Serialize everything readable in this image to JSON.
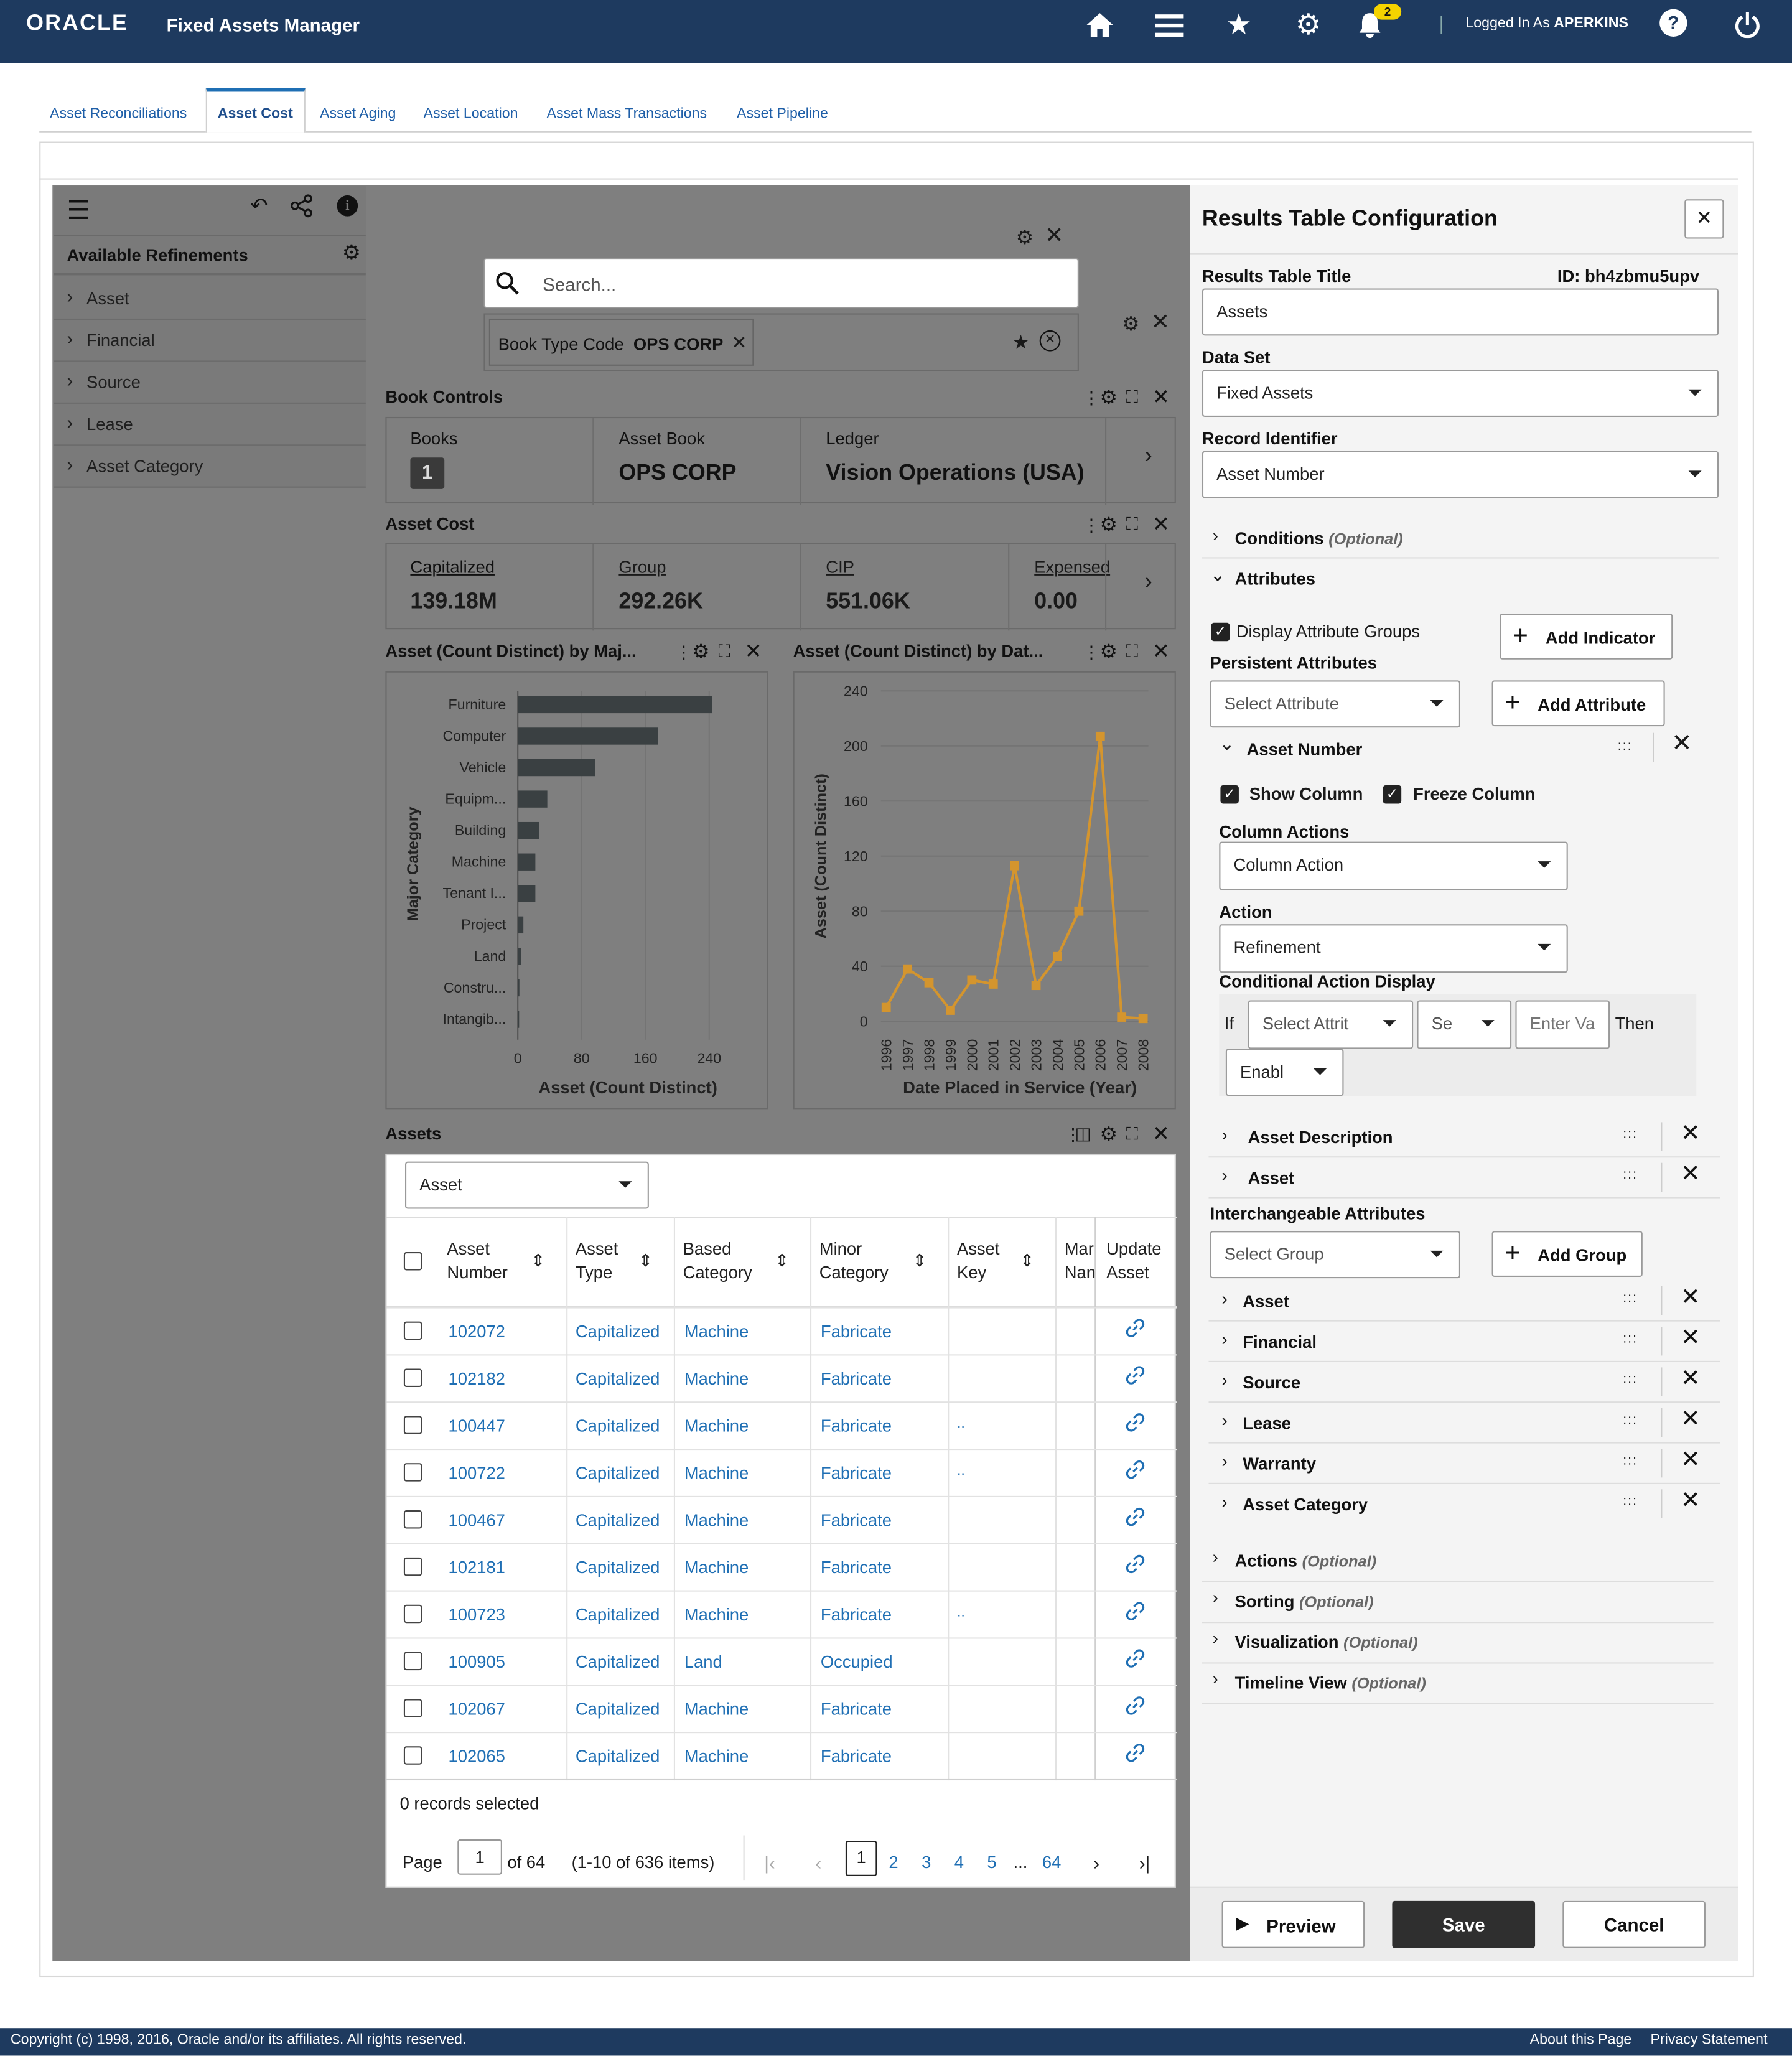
{
  "app": {
    "logo": "ORACLE",
    "title": "Fixed Assets Manager",
    "notification_count": "2",
    "logged_in_prefix": "Logged In As",
    "user": "APERKINS",
    "nav_icons": [
      "home-icon",
      "menu-icon",
      "star-icon",
      "gear-icon",
      "bell-icon",
      "help-icon",
      "power-icon"
    ]
  },
  "tabs": [
    "Asset Reconciliations",
    "Asset Cost",
    "Asset Aging",
    "Asset Location",
    "Asset Mass Transactions",
    "Asset Pipeline"
  ],
  "active_tab": "Asset Cost",
  "refinements": {
    "title": "Available Refinements",
    "items": [
      "Asset",
      "Financial",
      "Source",
      "Lease",
      "Asset Category"
    ]
  },
  "search": {
    "placeholder": "Search...",
    "chip_label": "Book Type Code",
    "chip_value": "OPS CORP"
  },
  "book_controls": {
    "title": "Book Controls",
    "books_label": "Books",
    "books_value": "1",
    "asset_book_label": "Asset Book",
    "asset_book_value": "OPS CORP",
    "ledger_label": "Ledger",
    "ledger_value": "Vision Operations (USA)"
  },
  "asset_cost": {
    "title": "Asset Cost",
    "metrics": [
      {
        "label": "Capitalized",
        "value": "139.18M"
      },
      {
        "label": "Group",
        "value": "292.26K"
      },
      {
        "label": "CIP",
        "value": "551.06K"
      },
      {
        "label": "Expensed",
        "value": "0.00"
      }
    ]
  },
  "charts": {
    "bar_title": "Asset (Count Distinct) by Maj...",
    "line_title": "Asset (Count Distinct) by Dat..."
  },
  "chart_data": [
    {
      "type": "bar",
      "orientation": "horizontal",
      "categories": [
        "Furniture",
        "Computer",
        "Vehicle",
        "Equipm...",
        "Building",
        "Machine",
        "Tenant I...",
        "Project",
        "Land",
        "Constru...",
        "Intangib..."
      ],
      "values": [
        244,
        176,
        97,
        37,
        27,
        22,
        22,
        7,
        4,
        2,
        1
      ],
      "xlabel": "Asset (Count Distinct)",
      "ylabel": "Major Category",
      "xticks": [
        "0",
        "80",
        "160",
        "240"
      ],
      "xlim": [
        0,
        240
      ]
    },
    {
      "type": "line",
      "x": [
        "1996",
        "1997",
        "1998",
        "1999",
        "2000",
        "2001",
        "2002",
        "2003",
        "2004",
        "2005",
        "2006",
        "2007",
        "2008"
      ],
      "values": [
        10,
        38,
        28,
        8,
        30,
        27,
        113,
        26,
        47,
        80,
        207,
        3,
        2
      ],
      "xlabel": "Date Placed in Service (Year)",
      "ylabel": "Asset (Count Distinct)",
      "yticks": [
        "0",
        "40",
        "80",
        "120",
        "160",
        "200",
        "240"
      ],
      "ylim": [
        0,
        240
      ],
      "color": "#d4952e"
    }
  ],
  "assets": {
    "title": "Assets",
    "selector_value": "Asset",
    "columns": [
      "Asset Number",
      "Asset Type",
      "Based Category",
      "Minor Category",
      "Asset Key",
      "Mar Nan",
      "Update Asset"
    ],
    "rows": [
      {
        "number": "102072",
        "type": "Capitalized",
        "based": "Machine",
        "minor": "Fabricate",
        "key": ""
      },
      {
        "number": "102182",
        "type": "Capitalized",
        "based": "Machine",
        "minor": "Fabricate",
        "key": ""
      },
      {
        "number": "100447",
        "type": "Capitalized",
        "based": "Machine",
        "minor": "Fabricate",
        "key": ".."
      },
      {
        "number": "100722",
        "type": "Capitalized",
        "based": "Machine",
        "minor": "Fabricate",
        "key": ".."
      },
      {
        "number": "100467",
        "type": "Capitalized",
        "based": "Machine",
        "minor": "Fabricate",
        "key": ""
      },
      {
        "number": "102181",
        "type": "Capitalized",
        "based": "Machine",
        "minor": "Fabricate",
        "key": ""
      },
      {
        "number": "100723",
        "type": "Capitalized",
        "based": "Machine",
        "minor": "Fabricate",
        "key": ".."
      },
      {
        "number": "100905",
        "type": "Capitalized",
        "based": "Land",
        "minor": "Occupied",
        "key": ""
      },
      {
        "number": "102067",
        "type": "Capitalized",
        "based": "Machine",
        "minor": "Fabricate",
        "key": ""
      },
      {
        "number": "102065",
        "type": "Capitalized",
        "based": "Machine",
        "minor": "Fabricate",
        "key": ""
      }
    ],
    "records_selected": "0 records selected",
    "page_label": "Page",
    "page_value": "1",
    "page_of": "of 64",
    "items_info": "(1-10 of 636 items)",
    "pages": [
      "1",
      "2",
      "3",
      "4",
      "5",
      "...",
      "64"
    ]
  },
  "config": {
    "title": "Results Table Configuration",
    "results_title_label": "Results Table Title",
    "id_label": "ID: bh4zbmu5upv",
    "results_title_value": "Assets",
    "dataset_label": "Data Set",
    "dataset_value": "Fixed Assets",
    "record_id_label": "Record Identifier",
    "record_id_value": "Asset Number",
    "conditions": "Conditions",
    "optional": "(Optional)",
    "attributes": "Attributes",
    "display_groups": "Display Attribute Groups",
    "add_indicator": "Add Indicator",
    "persistent": "Persistent Attributes",
    "select_attribute": "Select Attribute",
    "add_attribute": "Add Attribute",
    "asset_number": "Asset Number",
    "show_column": "Show Column",
    "freeze_column": "Freeze Column",
    "column_actions_label": "Column Actions",
    "column_action_value": "Column Action",
    "action_label": "Action",
    "action_value": "Refinement",
    "cond_display_label": "Conditional Action Display",
    "if": "If",
    "cond_attr": "Select Attrit",
    "cond_op": "Se",
    "cond_val_placeholder": "Enter Va",
    "then": "Then",
    "cond_result": "Enabl",
    "persistent_items": [
      "Asset Description",
      "Asset"
    ],
    "interchangeable": "Interchangeable Attributes",
    "select_group": "Select Group",
    "add_group": "Add Group",
    "groups": [
      "Asset",
      "Financial",
      "Source",
      "Lease",
      "Warranty",
      "Asset Category"
    ],
    "sections": [
      "Actions",
      "Sorting",
      "Visualization",
      "Timeline View"
    ],
    "preview": "Preview",
    "save": "Save",
    "cancel": "Cancel"
  },
  "footer": {
    "copyright": "Copyright (c) 1998, 2016, Oracle and/or its affiliates. All rights reserved.",
    "about": "About this Page",
    "privacy": "Privacy Statement"
  }
}
